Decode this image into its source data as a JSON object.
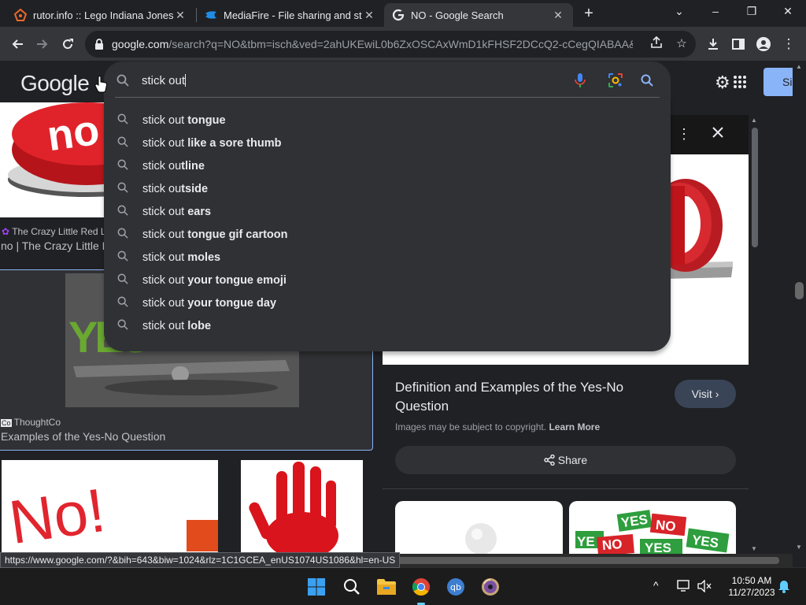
{
  "tabs": [
    {
      "title": "rutor.info :: Lego Indiana Jones 2:",
      "close": "✕"
    },
    {
      "title": "MediaFire - File sharing and stora",
      "close": "✕"
    },
    {
      "title": "NO - Google Search",
      "close": "✕"
    }
  ],
  "new_tab": "+",
  "window_controls": {
    "minimize": "–",
    "maximize": "❐",
    "close": "✕",
    "tablist": "⌄"
  },
  "address_bar": {
    "host": "google.com",
    "path": "/search?q=NO&tbm=isch&ved=2ahUKEwiL0b6ZxOSCAxWmD1kFHSF2DCcQ2-cCegQIABAA&o..."
  },
  "google": {
    "logo": "Google",
    "search_value": "stick out",
    "signin_label": "Si"
  },
  "suggestions": [
    {
      "prefix": "stick out",
      "rest": " tongue"
    },
    {
      "prefix": "stick out",
      "rest": " like a sore thumb"
    },
    {
      "prefix": "stick ou",
      "rest": "tline"
    },
    {
      "prefix": "stick ou",
      "rest": "tside"
    },
    {
      "prefix": "stick out",
      "rest": " ears"
    },
    {
      "prefix": "stick out",
      "rest": " tongue gif cartoon"
    },
    {
      "prefix": "stick out",
      "rest": " moles"
    },
    {
      "prefix": "stick out",
      "rest": " your tongue emoji"
    },
    {
      "prefix": "stick out",
      "rest": " your tongue day"
    },
    {
      "prefix": "stick out",
      "rest": " lobe"
    }
  ],
  "results": {
    "card1": {
      "source": "The Crazy Little Red L",
      "caption": "no | The Crazy Little R"
    },
    "card2": {
      "source": "ThoughtCo",
      "caption": "Examples of the Yes-No Question",
      "image_text": "YES"
    },
    "card3": {
      "image_text": "No!"
    },
    "card1_image_text": "no"
  },
  "preview": {
    "title": "Definition and Examples of the Yes-No Question",
    "visit_label": "Visit",
    "copyright_text": "Images may be subject to copyright.",
    "learn_more": "Learn More",
    "share_label": "Share",
    "thumb2_words": [
      "YES",
      "NO",
      "YE",
      "NO",
      "YES",
      "YES"
    ]
  },
  "status_url": "https://www.google.com/?&bih=643&biw=1024&rlz=1C1GCEA_enUS1074US1086&hl=en-US",
  "taskbar": {
    "time": "10:50 AM",
    "date": "11/27/2023",
    "chevron": "^"
  }
}
